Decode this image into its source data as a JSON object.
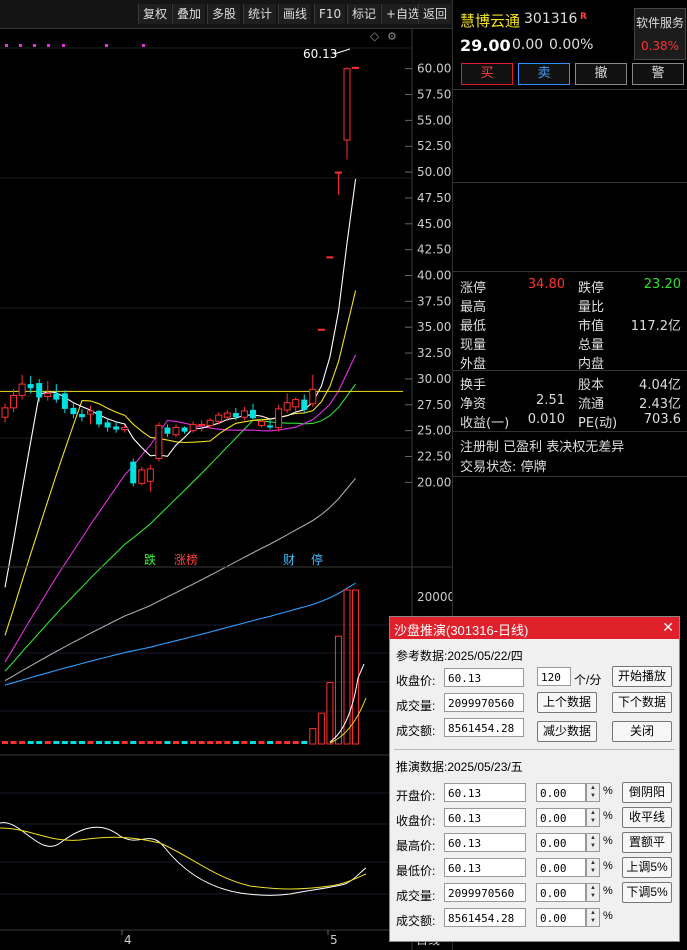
{
  "toolbar": {
    "buttons": [
      "复权",
      "叠加",
      "多股",
      "统计",
      "画线",
      "F10",
      "标记",
      "+自选",
      "返回"
    ]
  },
  "chart": {
    "max_price_label": "60.13",
    "price_ticks": [
      "60.00",
      "57.50",
      "55.00",
      "52.50",
      "50.00",
      "47.50",
      "45.00",
      "42.50",
      "40.00",
      "37.50",
      "35.00",
      "32.50",
      "30.00",
      "27.50",
      "25.00",
      "22.50",
      "20.00"
    ],
    "volume_ticks": [
      "20000"
    ],
    "markers": [
      {
        "text": "跌",
        "color": "#30ff30"
      },
      {
        "text": "涨榜",
        "color": "#ff4040"
      },
      {
        "text": "财",
        "color": "#40c0ff"
      },
      {
        "text": "停",
        "color": "#40c0ff"
      }
    ],
    "date_labels": [
      "4",
      "5"
    ],
    "axis_bottom_label": "日线",
    "colors": {
      "up": "#ff3030",
      "down": "#00e0e0",
      "ma5": "#ffffff",
      "ma10": "#f0e020",
      "ma20": "#e030e0",
      "ma30": "#30e030",
      "ma60": "#aaaaaa",
      "ma120": "#30a0ff",
      "hline": "#f0e020"
    }
  },
  "chart_data": {
    "type": "candlestick",
    "ylim": [
      18,
      62
    ],
    "candles": [
      {
        "o": 26.3,
        "h": 27.6,
        "l": 25.8,
        "c": 27.2
      },
      {
        "o": 27.2,
        "h": 29.0,
        "l": 26.8,
        "c": 28.4
      },
      {
        "o": 28.4,
        "h": 30.4,
        "l": 28.0,
        "c": 29.5
      },
      {
        "o": 29.5,
        "h": 30.3,
        "l": 28.6,
        "c": 29.1
      },
      {
        "o": 29.6,
        "h": 30.0,
        "l": 27.8,
        "c": 28.2
      },
      {
        "o": 28.3,
        "h": 29.8,
        "l": 27.9,
        "c": 28.6
      },
      {
        "o": 28.6,
        "h": 29.5,
        "l": 27.7,
        "c": 28.0
      },
      {
        "o": 28.6,
        "h": 28.9,
        "l": 26.7,
        "c": 27.1
      },
      {
        "o": 27.2,
        "h": 27.7,
        "l": 26.2,
        "c": 26.6
      },
      {
        "o": 26.6,
        "h": 27.1,
        "l": 25.9,
        "c": 26.3
      },
      {
        "o": 26.6,
        "h": 27.4,
        "l": 25.6,
        "c": 26.9
      },
      {
        "o": 26.9,
        "h": 27.0,
        "l": 25.3,
        "c": 25.6
      },
      {
        "o": 25.8,
        "h": 26.1,
        "l": 24.9,
        "c": 25.3
      },
      {
        "o": 25.4,
        "h": 25.8,
        "l": 24.8,
        "c": 25.1
      },
      {
        "o": 25.1,
        "h": 25.5,
        "l": 24.8,
        "c": 25.3
      },
      {
        "o": 22.0,
        "h": 22.3,
        "l": 19.6,
        "c": 19.9
      },
      {
        "o": 19.9,
        "h": 21.5,
        "l": 19.7,
        "c": 21.2
      },
      {
        "o": 20.1,
        "h": 21.7,
        "l": 19.1,
        "c": 21.3
      },
      {
        "o": 22.3,
        "h": 25.8,
        "l": 22.0,
        "c": 25.5
      },
      {
        "o": 25.3,
        "h": 25.6,
        "l": 24.4,
        "c": 24.7
      },
      {
        "o": 24.6,
        "h": 25.6,
        "l": 24.4,
        "c": 25.3
      },
      {
        "o": 25.3,
        "h": 25.4,
        "l": 24.7,
        "c": 24.9
      },
      {
        "o": 25.0,
        "h": 25.9,
        "l": 24.8,
        "c": 25.6
      },
      {
        "o": 25.5,
        "h": 26.0,
        "l": 24.9,
        "c": 25.6
      },
      {
        "o": 25.5,
        "h": 26.2,
        "l": 25.2,
        "c": 26.0
      },
      {
        "o": 25.9,
        "h": 26.8,
        "l": 25.6,
        "c": 26.5
      },
      {
        "o": 26.3,
        "h": 27.0,
        "l": 25.9,
        "c": 26.7
      },
      {
        "o": 26.7,
        "h": 27.2,
        "l": 26.0,
        "c": 26.3
      },
      {
        "o": 26.3,
        "h": 27.3,
        "l": 26.0,
        "c": 26.9
      },
      {
        "o": 27.0,
        "h": 27.6,
        "l": 26.1,
        "c": 26.2
      },
      {
        "o": 25.5,
        "h": 26.2,
        "l": 25.3,
        "c": 25.9
      },
      {
        "o": 25.5,
        "h": 26.1,
        "l": 25.1,
        "c": 25.3
      },
      {
        "o": 25.3,
        "h": 27.5,
        "l": 24.9,
        "c": 27.1
      },
      {
        "o": 27.0,
        "h": 28.6,
        "l": 26.7,
        "c": 27.7
      },
      {
        "o": 27.3,
        "h": 28.2,
        "l": 26.9,
        "c": 28.0
      },
      {
        "o": 28.0,
        "h": 28.5,
        "l": 26.7,
        "c": 27.0
      },
      {
        "o": 27.6,
        "h": 30.4,
        "l": 27.3,
        "c": 29.0
      },
      {
        "o": 34.8,
        "h": 34.8,
        "l": 34.8,
        "c": 34.8
      },
      {
        "o": 41.8,
        "h": 41.8,
        "l": 41.8,
        "c": 41.8
      },
      {
        "o": 50.0,
        "h": 50.0,
        "l": 47.8,
        "c": 50.0
      },
      {
        "o": 53.1,
        "h": 60.13,
        "l": 51.2,
        "c": 60.0
      },
      {
        "o": 60.13,
        "h": 60.13,
        "l": 60.13,
        "c": 60.13
      }
    ],
    "volume_max": 20000
  },
  "quote": {
    "name": "慧博云通",
    "code": "301316",
    "tag": "R",
    "price": "29.00",
    "change": "0.00",
    "change_pct": "0.00%",
    "sector_name": "软件服务",
    "sector_pct": "0.38%",
    "trade_buttons": [
      "买",
      "卖",
      "撤",
      "警"
    ],
    "rows1": [
      {
        "l1": "涨停",
        "v1": "34.80",
        "c1": "#ff3030",
        "l2": "跌停",
        "v2": "23.20",
        "c2": "#30e030"
      },
      {
        "l1": "最高",
        "v1": "",
        "c1": "#ddd",
        "l2": "量比",
        "v2": "",
        "c2": "#ddd"
      },
      {
        "l1": "最低",
        "v1": "",
        "c1": "#ddd",
        "l2": "市值",
        "v2": "117.2亿",
        "c2": "#ddd"
      },
      {
        "l1": "现量",
        "v1": "",
        "c1": "#ddd",
        "l2": "总量",
        "v2": "",
        "c2": "#ddd"
      },
      {
        "l1": "外盘",
        "v1": "",
        "c1": "#ddd",
        "l2": "内盘",
        "v2": "",
        "c2": "#ddd"
      }
    ],
    "rows2": [
      {
        "l1": "换手",
        "v1": "",
        "l2": "股本",
        "v2": "4.04亿"
      },
      {
        "l1": "净资",
        "v1": "2.51",
        "l2": "流通",
        "v2": "2.43亿"
      },
      {
        "l1": "收益(一)",
        "v1": "0.010",
        "l2": "PE(动)",
        "v2": "703.6"
      }
    ],
    "registration_note": "注册制 已盈利 表决权无差异",
    "trade_status": "交易状态: 停牌"
  },
  "dialog": {
    "title": "沙盘推演(301316-日线)",
    "ref_header": "参考数据:2025/05/22/四",
    "ref_close_label": "收盘价:",
    "ref_close": "60.13",
    "ref_volume_label": "成交量:",
    "ref_volume": "2099970560",
    "ref_amount_label": "成交额:",
    "ref_amount": "8561454.28",
    "speed": "120",
    "speed_unit": "个/分",
    "btn_start": "开始播放",
    "btn_prev": "上个数据",
    "btn_next": "下个数据",
    "btn_reduce": "减少数据",
    "btn_close": "关闭",
    "sim_header": "推演数据:2025/05/23/五",
    "sim_rows": [
      {
        "label": "开盘价:",
        "value": "60.13",
        "delta": "0.00",
        "button": "倒阴阳"
      },
      {
        "label": "收盘价:",
        "value": "60.13",
        "delta": "0.00",
        "button": "收平线"
      },
      {
        "label": "最高价:",
        "value": "60.13",
        "delta": "0.00",
        "button": "置额平"
      },
      {
        "label": "最低价:",
        "value": "60.13",
        "delta": "0.00",
        "button": "上调5%"
      },
      {
        "label": "成交量:",
        "value": "2099970560",
        "delta": "0.00",
        "button": "下调5%"
      },
      {
        "label": "成交额:",
        "value": "8561454.28",
        "delta": "0.00",
        "button": ""
      }
    ],
    "pct_sign": "%"
  }
}
